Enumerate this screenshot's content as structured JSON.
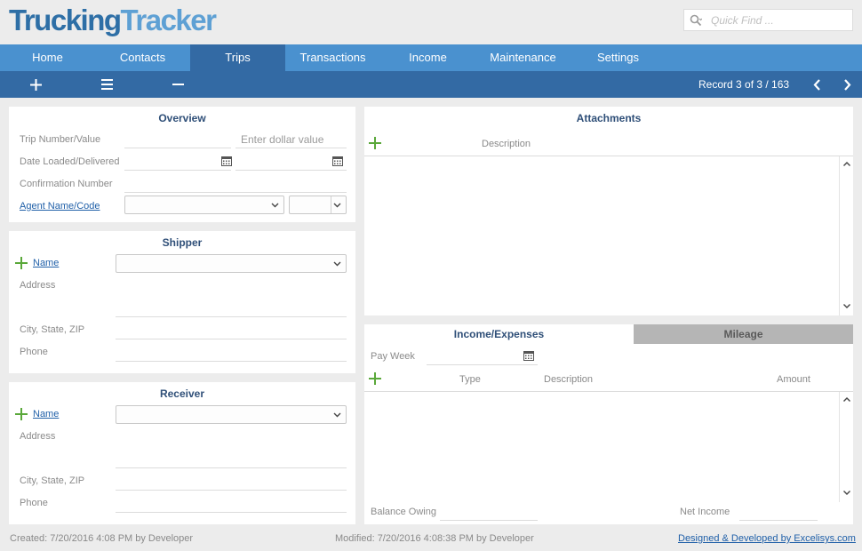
{
  "app": {
    "logo_part1": "Trucking",
    "logo_part2": "Tracker",
    "quickfind_placeholder": "Quick Find ..."
  },
  "nav": {
    "tabs": [
      {
        "label": "Home"
      },
      {
        "label": "Contacts"
      },
      {
        "label": "Trips"
      },
      {
        "label": "Transactions"
      },
      {
        "label": "Income"
      },
      {
        "label": "Maintenance"
      },
      {
        "label": "Settings"
      }
    ],
    "active": "Trips"
  },
  "toolbar": {
    "record_text": "Record 3 of 3 / 163"
  },
  "overview": {
    "title": "Overview",
    "trip_label": "Trip Number/Value",
    "trip_value_placeholder": "Enter dollar value",
    "date_label": "Date Loaded/Delivered",
    "confirmation_label": "Confirmation Number",
    "agent_label": "Agent Name/Code"
  },
  "shipper": {
    "title": "Shipper",
    "name_label": "Name",
    "address_label": "Address",
    "city_label": "City, State, ZIP",
    "phone_label": "Phone"
  },
  "receiver": {
    "title": "Receiver",
    "name_label": "Name",
    "address_label": "Address",
    "city_label": "City, State, ZIP",
    "phone_label": "Phone"
  },
  "attachments": {
    "title": "Attachments",
    "description_header": "Description"
  },
  "income": {
    "tab_income": "Income/Expenses",
    "tab_mileage": "Mileage",
    "pay_week_label": "Pay Week",
    "col_type": "Type",
    "col_description": "Description",
    "col_amount": "Amount",
    "balance_label": "Balance Owing",
    "net_label": "Net Income"
  },
  "footer": {
    "created": "Created: 7/20/2016 4:08 PM by Developer",
    "modified": "Modified: 7/20/2016 4:08:38 PM by Developer",
    "credit": "Designed & Developed by Excelisys.com"
  },
  "colors": {
    "nav_bg": "#4a91cf",
    "nav_active": "#336aa4",
    "toolbar_bg": "#336aa4",
    "title_text": "#2f4f78",
    "add_green": "#5aa83a",
    "link": "#1f5fa8"
  }
}
